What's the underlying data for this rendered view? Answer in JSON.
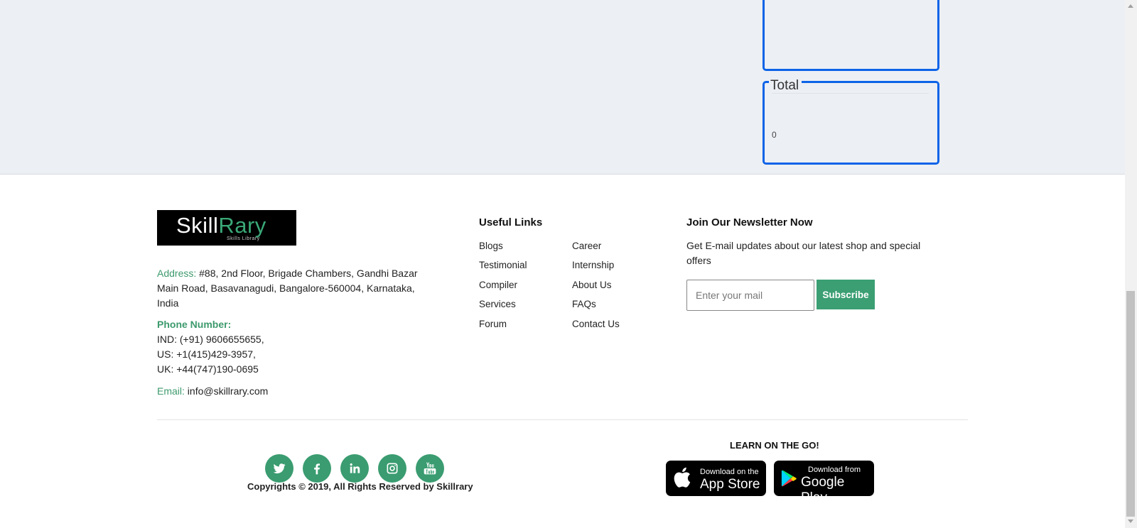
{
  "panel": {
    "title": "Total",
    "value": "0"
  },
  "footer": {
    "logo": {
      "word1": "Skill",
      "word2": "Rary",
      "tagline": "Skills Library"
    },
    "address_label": "Address:",
    "address_text": "#88, 2nd Floor, Brigade Chambers, Gandhi Bazar Main Road, Basavanagudi, Bangalore-560004, Karnataka, India",
    "phone_label": "Phone Number:",
    "phones": [
      "IND: (+91) 9606655655,",
      "US: +1(415)429-3957,",
      "UK: +44(747)190-0695"
    ],
    "email_label": "Email:",
    "email": "info@skillrary.com",
    "useful_links_title": "Useful Links",
    "links_col1": [
      "Blogs",
      "Testimonial",
      "Compiler",
      "Services",
      "Forum"
    ],
    "links_col2": [
      "Career",
      "Internship",
      "About Us",
      "FAQs",
      "Contact Us"
    ],
    "newsletter_title": "Join Our Newsletter Now",
    "newsletter_text": "Get E-mail updates about our latest shop and special offers",
    "email_placeholder": "Enter your mail",
    "subscribe_label": "Subscribe",
    "social": [
      "twitter-icon",
      "facebook-icon",
      "linkedin-icon",
      "instagram-icon",
      "youtube-icon"
    ],
    "copyright": "Copyrights © 2019, All Rights Reserved by Skillrary",
    "learn_title": "LEARN ON THE GO!",
    "app_store": {
      "small": "Download on the",
      "big": "App Store"
    },
    "google_play": {
      "small": "Download from",
      "big": "Google Play"
    }
  },
  "colors": {
    "accent": "#3a9c70",
    "panel_border": "#0d63e8",
    "top_bg": "#eceff4"
  }
}
